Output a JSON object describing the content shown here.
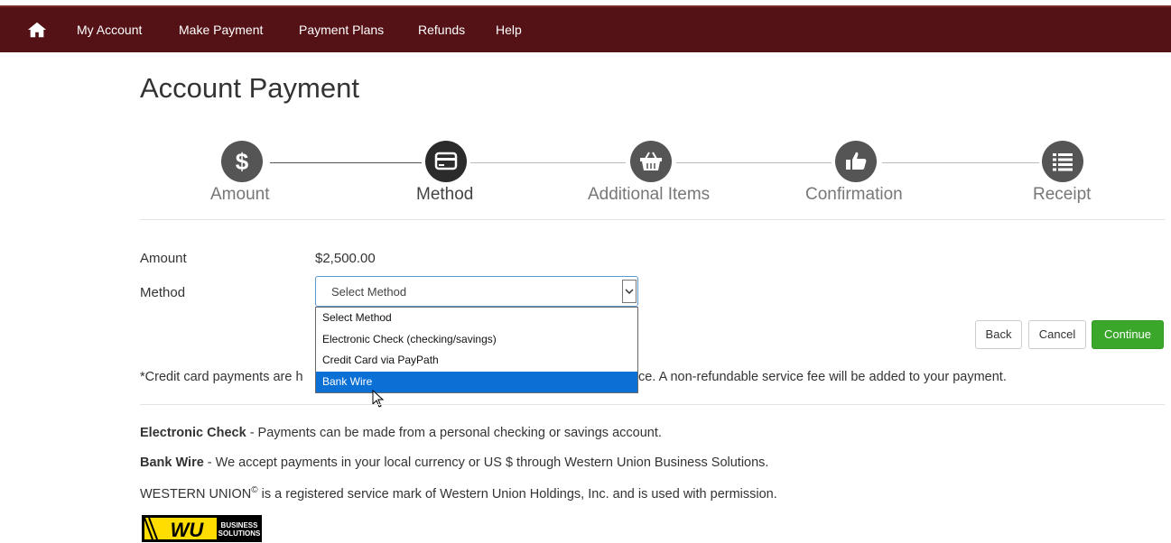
{
  "nav": {
    "home_icon": "home-icon",
    "items": [
      "My Account",
      "Make Payment",
      "Payment Plans",
      "Refunds",
      "Help"
    ]
  },
  "page": {
    "title": "Account Payment"
  },
  "stepper": {
    "steps": [
      {
        "label": "Amount",
        "icon": "dollar-icon",
        "active": false
      },
      {
        "label": "Method",
        "icon": "credit-card-icon",
        "active": true
      },
      {
        "label": "Additional Items",
        "icon": "basket-icon",
        "active": false
      },
      {
        "label": "Confirmation",
        "icon": "thumbs-up-icon",
        "active": false
      },
      {
        "label": "Receipt",
        "icon": "list-icon",
        "active": false
      }
    ]
  },
  "form": {
    "amount_label": "Amount",
    "amount_value": "$2,500.00",
    "method_label": "Method",
    "method_selected": "Select Method",
    "method_options": [
      "Select Method",
      "Electronic Check (checking/savings)",
      "Credit Card via PayPath",
      "Bank Wire"
    ],
    "highlighted_option": "Bank Wire"
  },
  "buttons": {
    "back": "Back",
    "cancel": "Cancel",
    "continue": "Continue"
  },
  "notes": {
    "credit_left": "*Credit card payments are h",
    "credit_right": "ce. A non-refundable service fee will be added to your payment."
  },
  "info": {
    "echeck_title": "Electronic Check",
    "echeck_text": " - Payments can be made from a personal checking or savings  account.",
    "wire_title": "Bank Wire",
    "wire_text": " - We accept payments in your local currency or US $ through Western Union Business Solutions.",
    "wu_prefix": "WESTERN UNION",
    "wu_sup": "©",
    "wu_text": " is a registered service mark of Western Union Holdings, Inc. and is used with permission."
  },
  "logo": {
    "mark": "WU",
    "line1": "BUSINESS",
    "line2": "SOLUTIONS"
  },
  "colors": {
    "nav_bg": "#541216",
    "primary_button": "#3aa62a",
    "selected_option": "#0a70d6"
  }
}
